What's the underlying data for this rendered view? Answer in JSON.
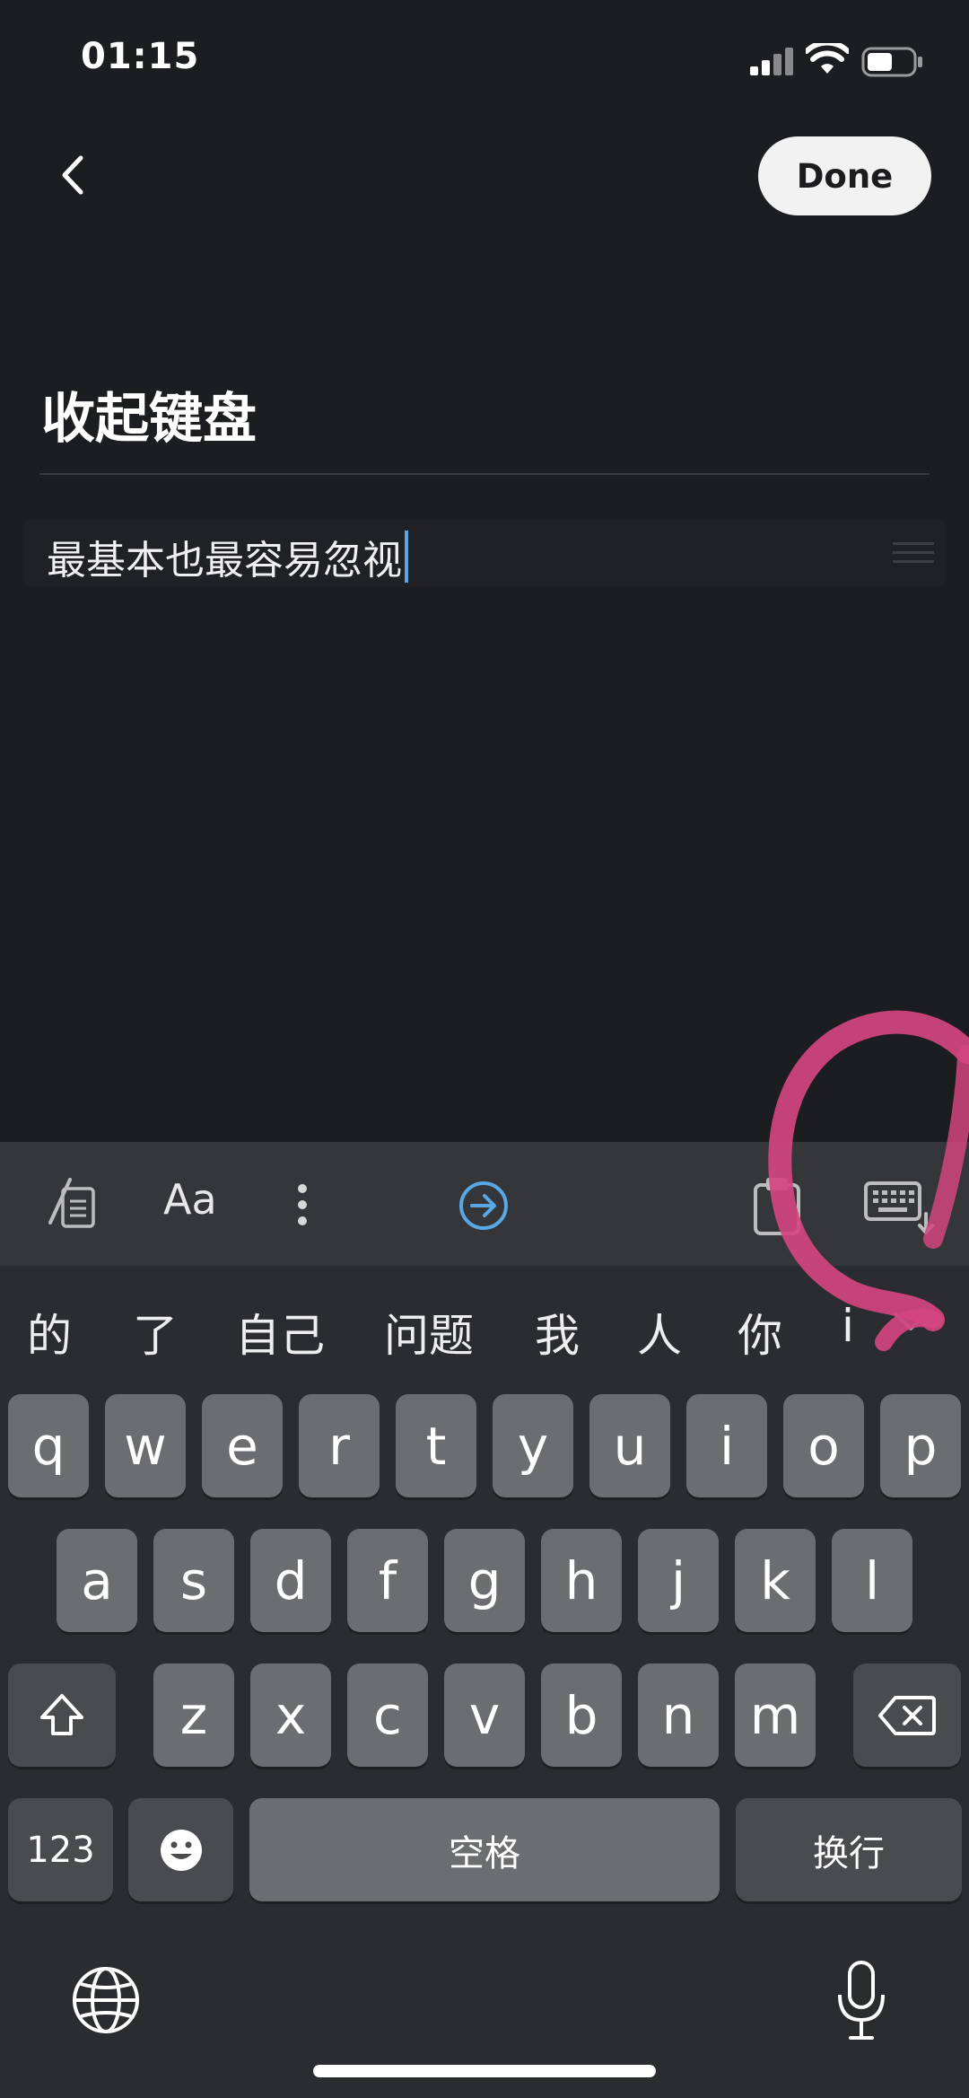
{
  "status_bar": {
    "time": "01:15"
  },
  "nav": {
    "done_label": "Done"
  },
  "editor": {
    "title": "收起键盘",
    "body_text": "最基本也最容易忽视"
  },
  "keyboard": {
    "toolbar": {
      "font_label": "Aa"
    },
    "candidates": [
      "的",
      "了",
      "自己",
      "问题",
      "我",
      "人",
      "你",
      "i"
    ],
    "row1": [
      "q",
      "w",
      "e",
      "r",
      "t",
      "y",
      "u",
      "i",
      "o",
      "p"
    ],
    "row2": [
      "a",
      "s",
      "d",
      "f",
      "g",
      "h",
      "j",
      "k",
      "l"
    ],
    "row3": [
      "z",
      "x",
      "c",
      "v",
      "b",
      "n",
      "m"
    ],
    "numbers_label": "123",
    "space_label": "空格",
    "return_label": "换行"
  },
  "colors": {
    "accent": "#5aa7e6",
    "annotation": "#d2457f"
  }
}
